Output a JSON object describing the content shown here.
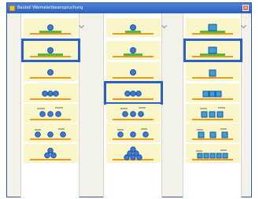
{
  "window": {
    "title": "Bauteil Wärmeleitbeanspruchung"
  }
}
